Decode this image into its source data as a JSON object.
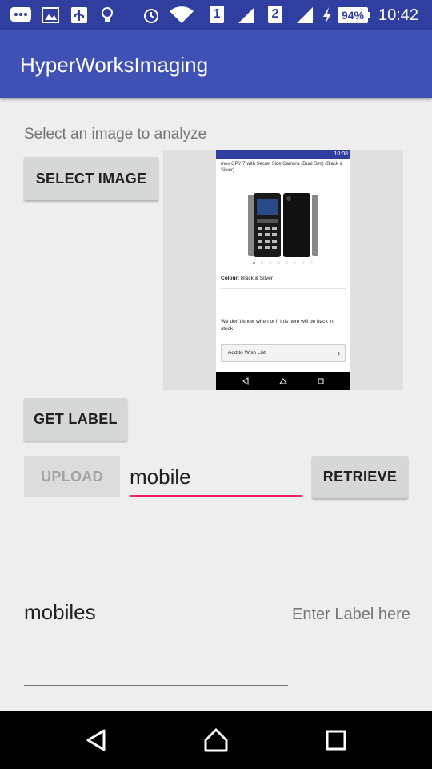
{
  "status_bar": {
    "time": "10:42",
    "battery": "94%",
    "sim1": "1",
    "sim2": "2",
    "icons": [
      "messaging-icon",
      "gallery-icon",
      "usb-icon",
      "lightbulb-icon",
      "alarm-icon",
      "wifi-icon",
      "sim1-signal-icon",
      "sim2-signal-icon",
      "charging-icon",
      "battery-icon"
    ]
  },
  "toolbar": {
    "title": "HyperWorksImaging"
  },
  "main": {
    "prompt": "Select an image to analyze",
    "select_image_label": "SELECT IMAGE",
    "get_label_label": "GET LABEL",
    "upload_label": "UPLOAD",
    "retrieve_label": "RETRIEVE",
    "label_input_value": "mobile",
    "result_text": "mobiles",
    "enter_label_placeholder": "Enter Label here"
  },
  "preview_image": {
    "status_time": "10:08",
    "product_title": "mox GPY 7 with Secret Side Camera (Dual Sim) (Black & Silver)",
    "carousel_dots": "● ○ ○ ○ ○ ○ ○ ○",
    "colour_label": "Colour:",
    "colour_value": "Black & Silver",
    "stock_text": "We don't know when or if this item will be back in stock.",
    "wishlist_label": "Add to Wish List"
  },
  "navbar": {
    "icons": [
      "back-icon",
      "home-icon",
      "recents-icon"
    ]
  },
  "colors": {
    "primary": "#3f51b5",
    "primary_dark": "#303f9f",
    "accent": "#e91e63"
  }
}
